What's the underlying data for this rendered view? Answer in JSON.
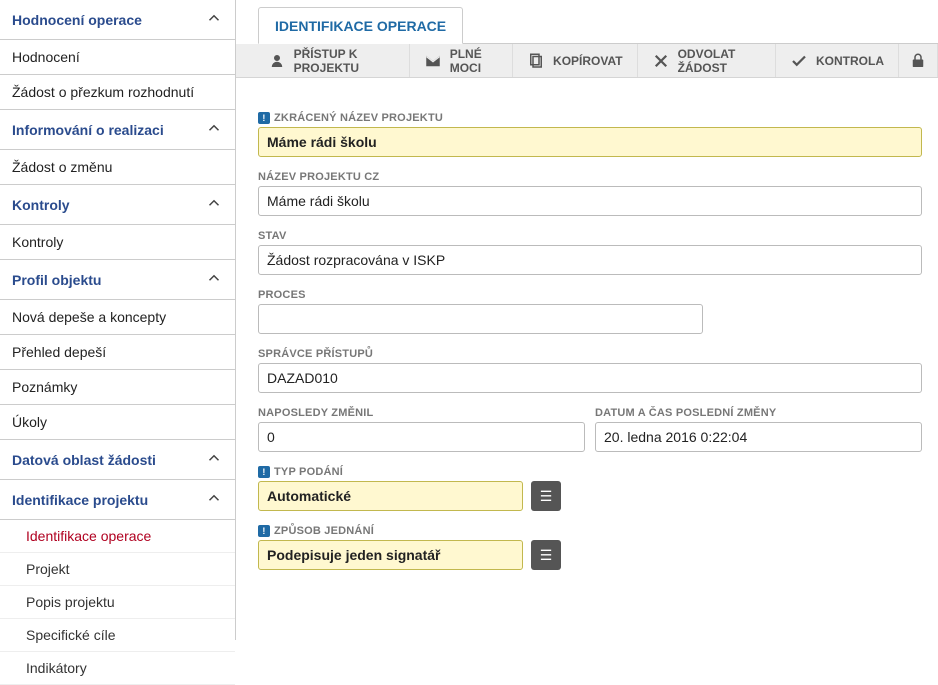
{
  "sidebar": {
    "groups": [
      {
        "title": "Hodnocení operace",
        "items": [
          "Hodnocení",
          "Žádost o přezkum rozhodnutí"
        ]
      },
      {
        "title": "Informování o realizaci",
        "items": [
          "Žádost o změnu"
        ]
      },
      {
        "title": "Kontroly",
        "items": [
          "Kontroly"
        ]
      },
      {
        "title": "Profil objektu",
        "items": [
          "Nová depeše a koncepty",
          "Přehled depeší",
          "Poznámky",
          "Úkoly"
        ]
      },
      {
        "title": "Datová oblast žádosti",
        "items": []
      },
      {
        "title": "Identifikace projektu",
        "subs": [
          "Identifikace operace",
          "Projekt",
          "Popis projektu",
          "Specifické cíle",
          "Indikátory"
        ],
        "active_sub": 0
      }
    ]
  },
  "tab": {
    "label": "IDENTIFIKACE OPERACE"
  },
  "toolbar": {
    "access": "PŘÍSTUP K PROJEKTU",
    "power": "PLNÉ MOCI",
    "copy": "KOPÍROVAT",
    "revoke": "ODVOLAT ŽÁDOST",
    "check": "KONTROLA"
  },
  "fields": {
    "short_name": {
      "label": "ZKRÁCENÝ NÁZEV PROJEKTU",
      "value": "Máme rádi školu"
    },
    "name_cz": {
      "label": "NÁZEV PROJEKTU CZ",
      "value": "Máme rádi školu"
    },
    "state": {
      "label": "STAV",
      "value": "Žádost rozpracována v ISKP"
    },
    "process": {
      "label": "PROCES",
      "value": ""
    },
    "admin": {
      "label": "SPRÁVCE PŘÍSTUPŮ",
      "value": "DAZAD010"
    },
    "last_changed_by": {
      "label": "NAPOSLEDY ZMĚNIL",
      "value": "0"
    },
    "last_changed_at": {
      "label": "DATUM A ČAS POSLEDNÍ ZMĚNY",
      "value": "20. ledna 2016 0:22:04"
    },
    "submit_type": {
      "label": "TYP PODÁNÍ",
      "value": "Automatické"
    },
    "acting_mode": {
      "label": "ZPŮSOB JEDNÁNÍ",
      "value": "Podepisuje jeden signatář"
    }
  }
}
